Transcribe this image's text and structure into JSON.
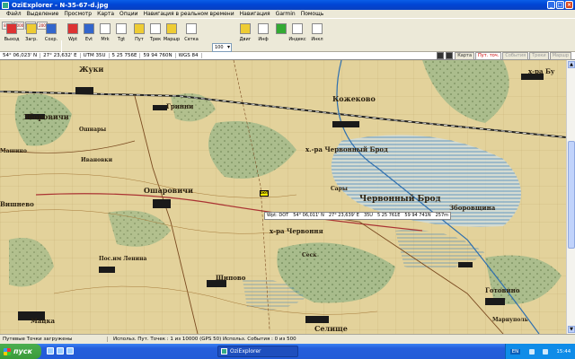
{
  "window": {
    "title": "OziExplorer - N-35-67-d.jpg",
    "buttons": [
      "_",
      "□",
      "×"
    ]
  },
  "menu": [
    "Файл",
    "Выделение",
    "Просмотр",
    "Карта",
    "Опции",
    "Навигация в реальном времени",
    "Навигация",
    "Garmin",
    "Помощь"
  ],
  "toolbar": {
    "small_buttons": [
      "800",
      "1000",
      "500",
      "200"
    ],
    "buttons": [
      {
        "label": "Выход",
        "icon": "exit-icon"
      },
      {
        "label": "Загр.",
        "icon": "load-icon"
      },
      {
        "label": "Сохр.",
        "icon": "save-icon"
      },
      {
        "label": "Wpt",
        "icon": "waypoint-icon"
      },
      {
        "label": "Evt",
        "icon": "event-icon"
      },
      {
        "label": "Mrk",
        "icon": "mark-icon"
      },
      {
        "label": "Tgt",
        "icon": "target-icon"
      },
      {
        "label": "Пут",
        "icon": "route-icon"
      },
      {
        "label": "Трек",
        "icon": "track-icon"
      },
      {
        "label": "Маршр",
        "icon": "path-icon"
      },
      {
        "label": "Сетка",
        "icon": "grid-icon"
      },
      {
        "label": "Двиг",
        "icon": "move-icon"
      },
      {
        "label": "Инф",
        "icon": "info-icon"
      },
      {
        "label": "Индекс",
        "icon": "index-icon"
      },
      {
        "label": "Инкл",
        "icon": "include-icon"
      }
    ],
    "zoom_value": "100"
  },
  "coords": {
    "lat": "54° 06,023' N",
    "lon": "27° 23,632' E",
    "utm": "UTM  35U",
    "easting": "5 25 756E",
    "northing": "59 94 760N",
    "datum": "WGS 84",
    "tabs": [
      "Карта",
      "Пут. точ.",
      "События",
      "Треки",
      "Маршр"
    ]
  },
  "map": {
    "labels": [
      "Жуки",
      "Зборовичи",
      "Гринни",
      "Кожеково",
      "Ошнары",
      "х.-ра Червонный Брод",
      "Ошаровичи",
      "Ивановки",
      "Червонный Брод",
      "Сары",
      "х-ра Червоння",
      "Сеск",
      "Пос.им Ленина",
      "Шипово",
      "Вишнево",
      "Мацка",
      "Селище",
      "Готовино",
      "Марнуполь",
      "Машино",
      "Зборовщина",
      "х-ра Бу"
    ]
  },
  "waypoint": {
    "marker": "DOT",
    "info": [
      "Wpt: DOT",
      "54° 06,011' N",
      "27° 23,639' E",
      "35U",
      "5 25 761E",
      "59 94 741N",
      "257m"
    ]
  },
  "status": {
    "left": "Путевые Точки загружены",
    "right": "Использ. Пут. Точек : 1 из 10000  (GPS 50)  Использ. События : 0 из 500"
  },
  "taskbar": {
    "start": "пуск",
    "task": "OziExplorer",
    "lang": "EN",
    "time": "15:44"
  }
}
